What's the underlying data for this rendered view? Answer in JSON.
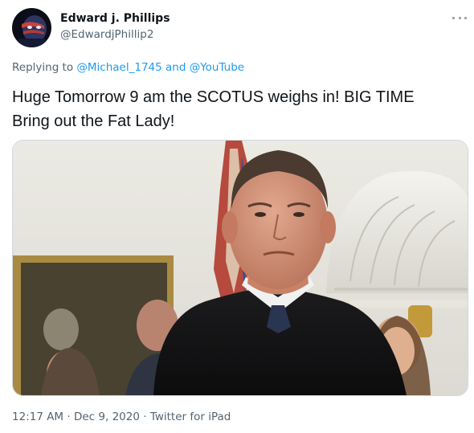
{
  "user": {
    "display_name": "Edward j. Phillips",
    "handle": "@EdwardjPhillip2",
    "avatar_icon": "avatar-image"
  },
  "reply": {
    "prefix": "Replying to",
    "mention1": "@Michael_1745",
    "conjunction": "and",
    "mention2": "@YouTube"
  },
  "tweet": {
    "text_line1": "Huge Tomorrow 9 am the SCOTUS weighs in! BIG TIME",
    "text_line2": "Bring out the Fat Lady!"
  },
  "media": {
    "icon": "photo"
  },
  "meta": {
    "time": "12:17 AM",
    "sep1": "·",
    "date": "Dec 9, 2020",
    "sep2": "·",
    "source": "Twitter for iPad"
  },
  "colors": {
    "link": "#1d9bf0",
    "secondary_text": "#536471",
    "primary_text": "#0f1419",
    "border": "#cfd9de"
  }
}
